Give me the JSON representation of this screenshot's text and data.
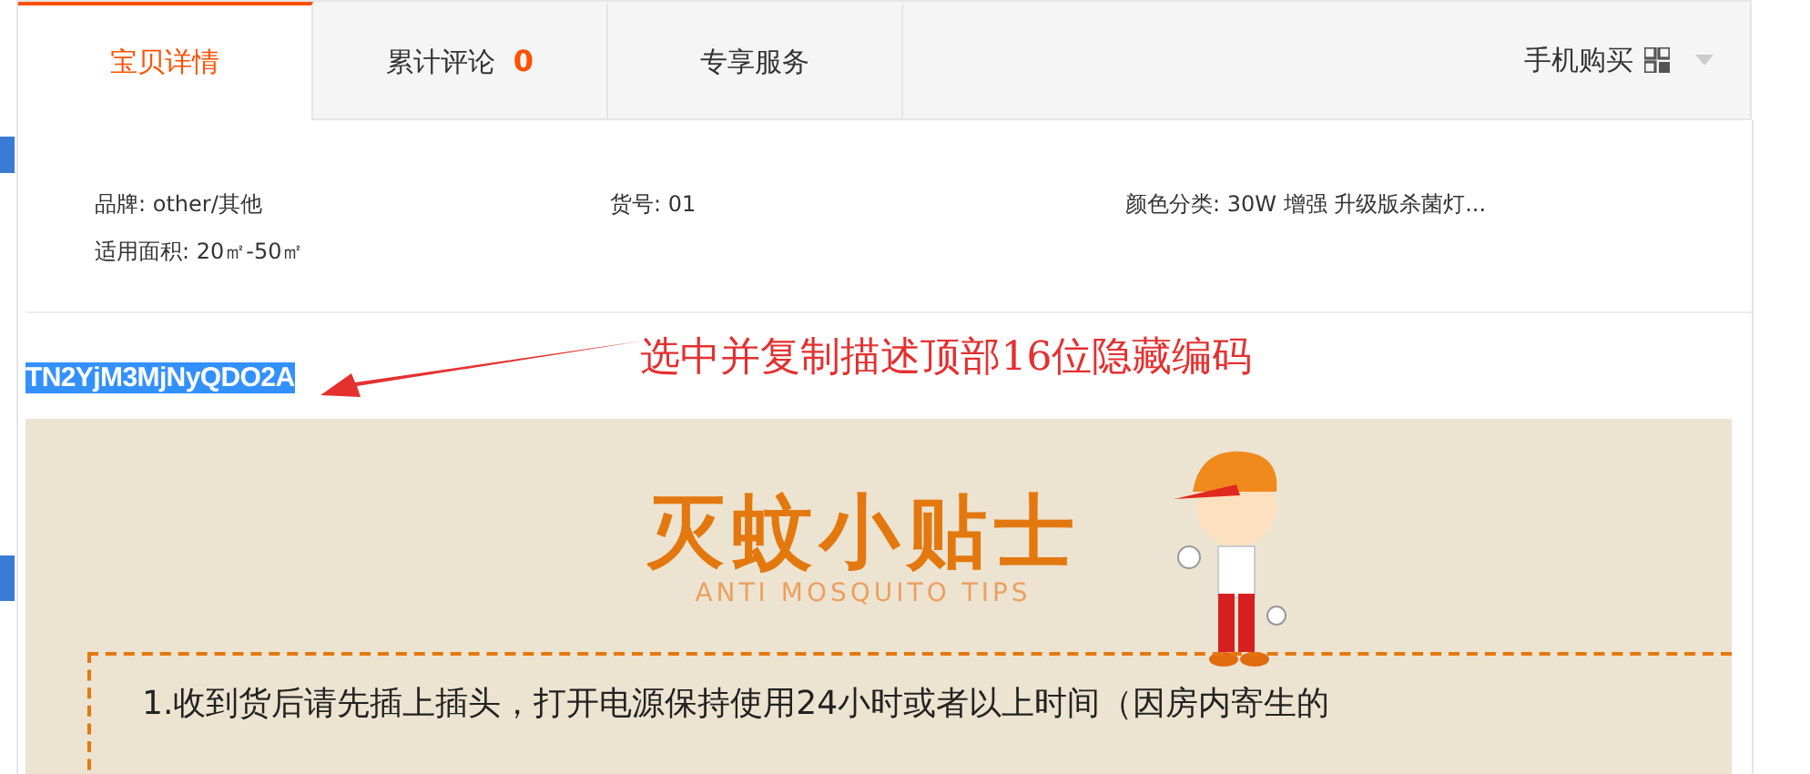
{
  "tabs": [
    {
      "label": "宝贝详情",
      "selected": true
    },
    {
      "label": "累计评论",
      "count": "0",
      "selected": false
    },
    {
      "label": "专享服务",
      "selected": false
    }
  ],
  "mobile_buy": {
    "label": "手机购买"
  },
  "attributes": [
    {
      "text": "品牌: other/其他"
    },
    {
      "text": "货号: 01"
    },
    {
      "text": "颜色分类: 30W 增强 升级版杀菌灯..."
    },
    {
      "text": "适用面积: 20㎡-50㎡"
    }
  ],
  "hidden_code": {
    "text": "TN2YjM3MjNyQDO2A",
    "selected": true
  },
  "annotation": {
    "text": "选中并复制描述顶部16位隐藏编码"
  },
  "banner": {
    "title": "灭蚊小贴士",
    "subtitle": "ANTI MOSQUITO TIPS",
    "tip": "1.收到货后请先插上插头，打开电源保持使用24小时或者以上时间（因房内寄生的"
  }
}
